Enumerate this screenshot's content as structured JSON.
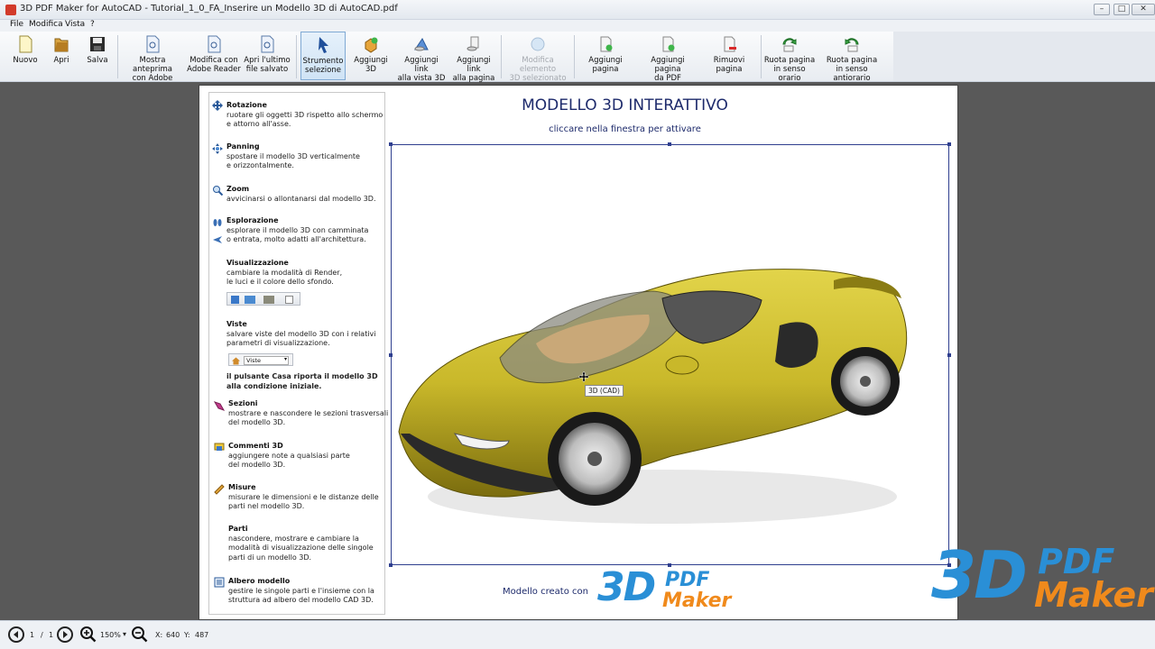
{
  "window": {
    "title": "3D PDF Maker for AutoCAD - Tutorial_1_0_FA_Inserire un Modello 3D di AutoCAD.pdf",
    "minimize": "–",
    "restore": "□",
    "close": "✕"
  },
  "menu": [
    "File",
    "Modifica",
    "Vista",
    "?"
  ],
  "toolbar": {
    "nuovo": "Nuovo",
    "apri": "Apri",
    "salva": "Salva",
    "anteprima": [
      "Mostra anteprima",
      "con Adobe Reader"
    ],
    "modifica": [
      "Modifica con",
      "Adobe Reader"
    ],
    "ultimo": [
      "Apri l'ultimo",
      "file salvato"
    ],
    "strumento": [
      "Strumento",
      "selezione"
    ],
    "aggiungi3d": "Aggiungi 3D",
    "linkvista": [
      "Aggiungi link",
      "alla vista 3D"
    ],
    "linkpagina": [
      "Aggiungi link",
      "alla pagina"
    ],
    "modificaelemento": [
      "Modifica elemento",
      "3D selezionato"
    ],
    "aggiungipagina": "Aggiungi pagina",
    "aggiungipdf": [
      "Aggiungi pagina",
      "da PDF"
    ],
    "rimuovi": "Rimuovi pagina",
    "orario": [
      "Ruota pagina",
      "in senso orario"
    ],
    "antiorario": [
      "Ruota pagina",
      "in senso antiorario"
    ]
  },
  "sidebar": [
    {
      "title": "Rotazione",
      "lines": [
        "ruotare gli oggetti 3D rispetto allo schermo",
        "e attorno all'asse."
      ]
    },
    {
      "title": "Panning",
      "lines": [
        "spostare il modello 3D verticalmente",
        "e orizzontalmente."
      ]
    },
    {
      "title": "Zoom",
      "lines": [
        "avvicinarsi o allontanarsi dal modello 3D."
      ]
    },
    {
      "title": "Esplorazione",
      "lines": [
        "esplorare il modello 3D con camminata",
        "o entrata, molto adatti all'architettura."
      ]
    },
    {
      "title": "Visualizzazione",
      "lines": [
        "cambiare la modalità di Render,",
        "le luci e il colore dello sfondo."
      ]
    },
    {
      "title": "Viste",
      "lines": [
        "salvare viste del modello 3D con i relativi",
        "parametri di visualizzazione."
      ]
    },
    {
      "title": "",
      "lines": [
        "il pulsante Casa riporta il modello 3D",
        "alla condizione iniziale."
      ]
    },
    {
      "title": "Sezioni",
      "lines": [
        "mostrare e nascondere le sezioni trasversali",
        "del modello 3D."
      ]
    },
    {
      "title": "Commenti 3D",
      "lines": [
        "aggiungere note a qualsiasi parte",
        "del modello 3D."
      ]
    },
    {
      "title": "Misure",
      "lines": [
        "misurare le dimensioni e le distanze delle",
        "parti nel modello 3D."
      ]
    },
    {
      "title": "Parti",
      "lines": [
        "nascondere, mostrare e cambiare la",
        "modalità di visualizzazione delle singole",
        "parti di un modello 3D."
      ]
    },
    {
      "title": "Albero modello",
      "lines": [
        "gestire le singole parti e l'insieme con la",
        "struttura ad albero del modello CAD 3D."
      ]
    }
  ],
  "views_dropdown": "Viste",
  "page": {
    "title": "MODELLO 3D INTERATTIVO",
    "subtitle": "cliccare nella finestra per attivare",
    "tooltip": "3D (CAD)",
    "created_by": "Modello creato con",
    "logo_3d": "3D",
    "logo_pdf": "PDF",
    "logo_maker": "Maker"
  },
  "status": {
    "page_current": "1",
    "page_sep": "/",
    "page_total": "1",
    "zoom": "150%",
    "x_label": "X:",
    "x_value": "640",
    "y_label": "Y:",
    "y_value": "487"
  },
  "colors": {
    "car_body": "#c9b82a",
    "accent_blue": "#2a8fd6",
    "accent_orange": "#f08a1c",
    "title_navy": "#1d2a6b"
  }
}
